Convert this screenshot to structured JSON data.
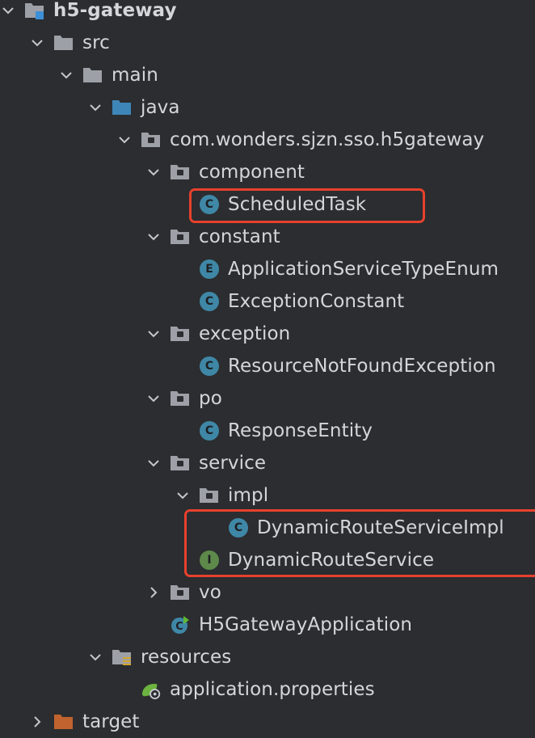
{
  "tree": {
    "rows": [
      {
        "label": "h5-gateway",
        "kind": "module",
        "chevron": "down",
        "bold": true
      },
      {
        "label": "src",
        "kind": "folder",
        "chevron": "down"
      },
      {
        "label": "main",
        "kind": "folder",
        "chevron": "down"
      },
      {
        "label": "java",
        "kind": "source-folder",
        "chevron": "down"
      },
      {
        "label": "com.wonders.sjzn.sso.h5gateway",
        "kind": "package",
        "chevron": "down"
      },
      {
        "label": "component",
        "kind": "package",
        "chevron": "down"
      },
      {
        "label": "ScheduledTask",
        "kind": "class",
        "badge": "C"
      },
      {
        "label": "constant",
        "kind": "package",
        "chevron": "down"
      },
      {
        "label": "ApplicationServiceTypeEnum",
        "kind": "enum",
        "badge": "E"
      },
      {
        "label": "ExceptionConstant",
        "kind": "class",
        "badge": "C"
      },
      {
        "label": "exception",
        "kind": "package",
        "chevron": "down"
      },
      {
        "label": "ResourceNotFoundException",
        "kind": "class",
        "badge": "C"
      },
      {
        "label": "po",
        "kind": "package",
        "chevron": "down"
      },
      {
        "label": "ResponseEntity",
        "kind": "class",
        "badge": "C"
      },
      {
        "label": "service",
        "kind": "package",
        "chevron": "down"
      },
      {
        "label": "impl",
        "kind": "package",
        "chevron": "down"
      },
      {
        "label": "DynamicRouteServiceImpl",
        "kind": "class",
        "badge": "C"
      },
      {
        "label": "DynamicRouteService",
        "kind": "interface",
        "badge": "I"
      },
      {
        "label": "vo",
        "kind": "package",
        "chevron": "right"
      },
      {
        "label": "H5GatewayApplication",
        "kind": "spring-app"
      },
      {
        "label": "resources",
        "kind": "resources-folder",
        "chevron": "down"
      },
      {
        "label": "application.properties",
        "kind": "properties"
      },
      {
        "label": "target",
        "kind": "excluded-folder",
        "chevron": "right"
      }
    ]
  },
  "colors": {
    "background": "#2b2d30",
    "text": "#d3d6db",
    "highlight": "#e8412d",
    "class_badge": "#3f87a6",
    "interface_badge": "#5d8a4a",
    "folder": "#9da0a6",
    "source_folder": "#3e86b8",
    "excluded_folder": "#c0632e"
  }
}
